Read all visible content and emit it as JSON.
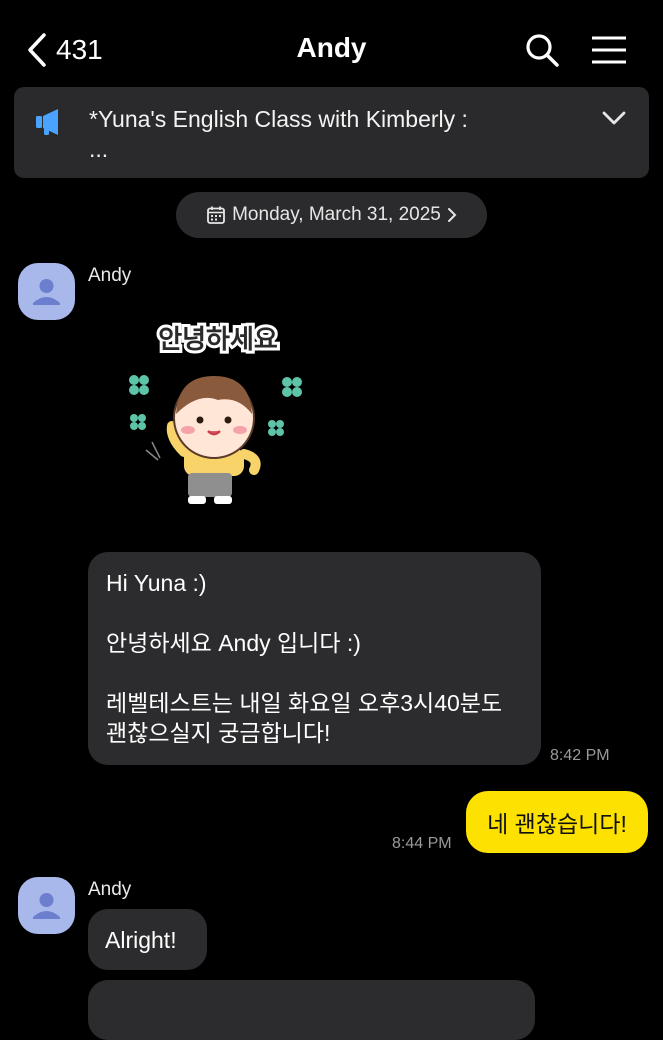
{
  "header": {
    "back_count": "431",
    "title": "Andy"
  },
  "notice": {
    "line1": "*Yuna's English Class with Kimberly :",
    "line2": "..."
  },
  "date_pill": {
    "label": "Monday, March 31, 2025"
  },
  "messages": [
    {
      "sender": "Andy",
      "paragraphs": [
        "Hi Yuna :)",
        "안녕하세요 Andy 입니다 :)",
        "레벨테스트는 내일 화요일 오후3시40분도",
        "괜찮으실지 궁금합니다!"
      ],
      "time": "8:42 PM"
    },
    {
      "sender": "me",
      "text": "네 괜찮습니다!",
      "time": "8:44 PM"
    },
    {
      "sender": "Andy",
      "text": "Alright!"
    }
  ],
  "sticker": {
    "caption": "안녕하세요"
  },
  "colors": {
    "background": "#000000",
    "bubble_incoming": "#2c2c2e",
    "bubble_outgoing": "#fde100",
    "avatar": "#a8b8ea",
    "notice_icon": "#4aa3ff"
  },
  "icons": {
    "back": "chevron-left-icon",
    "search": "search-icon",
    "menu": "hamburger-menu-icon",
    "notice": "megaphone-icon",
    "expand": "chevron-down-icon",
    "calendar": "calendar-icon"
  }
}
